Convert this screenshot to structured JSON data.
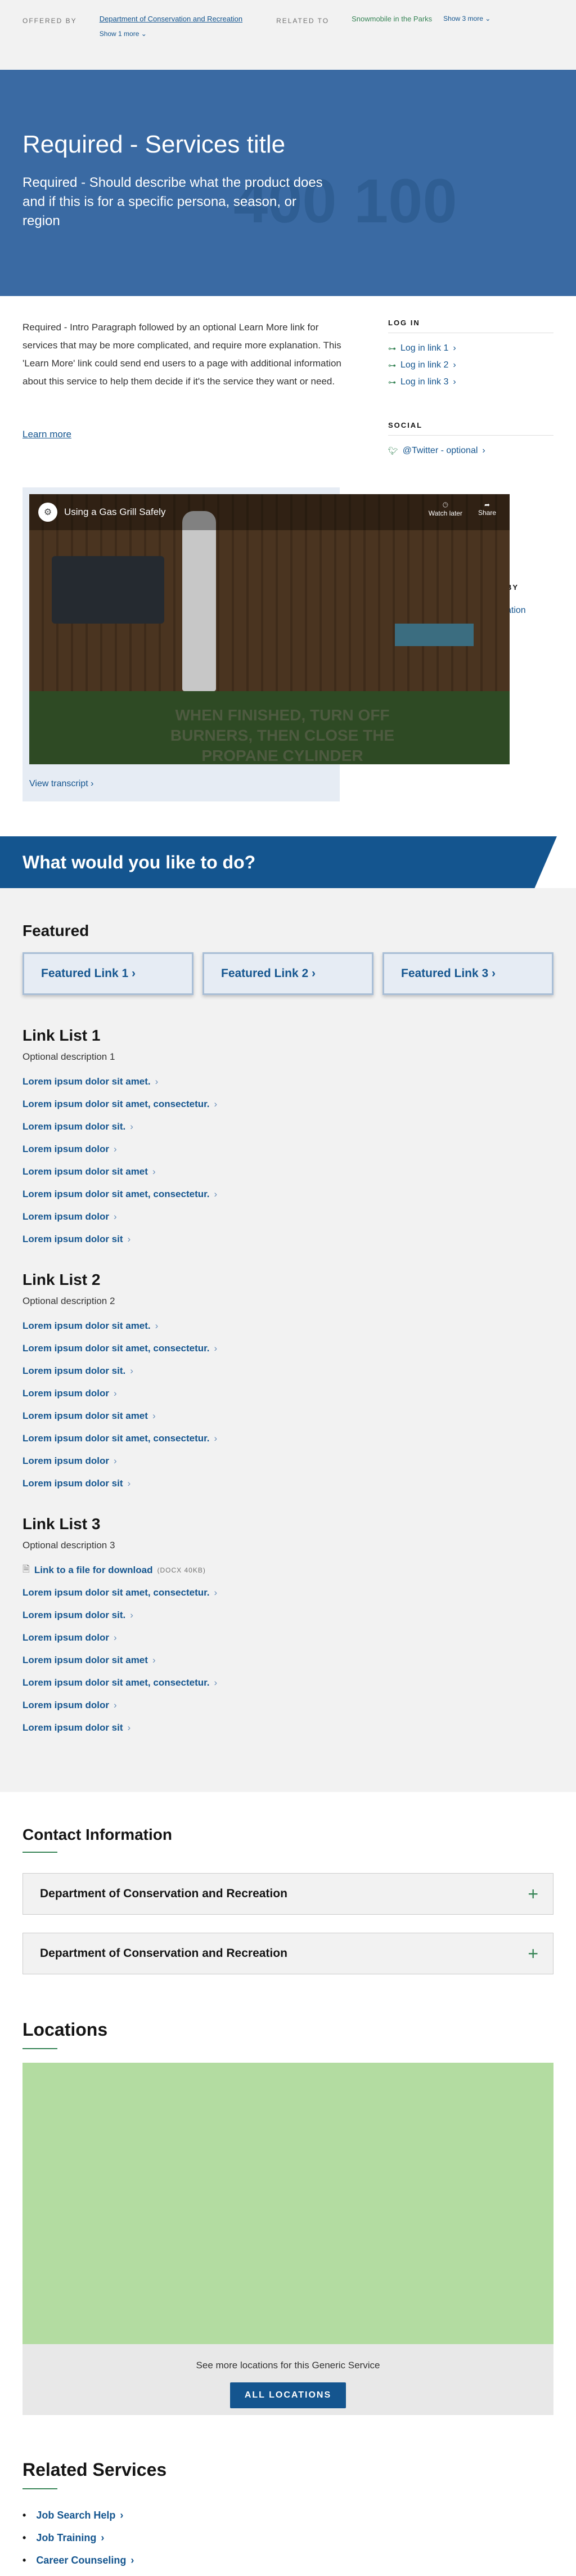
{
  "relationship": {
    "offered_by_label": "OFFERED BY",
    "offered_by_link": "Department of Conservation and Recreation",
    "offered_more": "Show 1 more",
    "related_label": "RELATED TO",
    "related_link": "Snowmobile in the Parks",
    "related_more": "Show 3 more"
  },
  "hero": {
    "title": "Required - Services title",
    "description": "Required - Should describe what the product does and if this is for a specific persona, season, or region",
    "watermark": "400 100"
  },
  "intro": {
    "text": "Required - Intro Paragraph followed by an optional Learn More link for services that may be more complicated, and require more explanation. This 'Learn More' link could send end users to a page with additional information about this service to help them decide if it's the service they want or need.",
    "learn_more": "Learn more"
  },
  "sidebar": {
    "login_title": "LOG IN",
    "login_links": [
      "Log in link 1",
      "Log in link 2",
      "Log in link 3"
    ],
    "social_title": "SOCIAL",
    "social_links": [
      "@Twitter - optional"
    ],
    "by_title": "BY",
    "by_link": "ation"
  },
  "video": {
    "title": "Using a Gas Grill Safely",
    "watch_later": "Watch later",
    "share": "Share",
    "caption": "WHEN FINISHED, TURN OFF BURNERS, THEN CLOSE THE PROPANE CYLINDER",
    "transcript": "View transcript"
  },
  "tasks": {
    "heading": "What would you like to do?",
    "featured_title": "Featured",
    "featured_links": [
      "Featured Link 1",
      "Featured Link 2",
      "Featured Link 3"
    ]
  },
  "link_lists": [
    {
      "title": "Link List 1",
      "description": "Optional description 1",
      "items": [
        "Lorem ipsum dolor sit amet.",
        "Lorem ipsum dolor sit amet, consectetur.",
        "Lorem ipsum dolor sit.",
        "Lorem ipsum dolor",
        "Lorem ipsum dolor sit amet",
        "Lorem ipsum dolor sit amet, consectetur.",
        "Lorem ipsum dolor",
        "Lorem ipsum dolor sit"
      ]
    },
    {
      "title": "Link List 2",
      "description": "Optional description 2",
      "items": [
        "Lorem ipsum dolor sit amet.",
        "Lorem ipsum dolor sit amet, consectetur.",
        "Lorem ipsum dolor sit.",
        "Lorem ipsum dolor",
        "Lorem ipsum dolor sit amet",
        "Lorem ipsum dolor sit amet, consectetur.",
        "Lorem ipsum dolor",
        "Lorem ipsum dolor sit"
      ]
    },
    {
      "title": "Link List 3",
      "description": "Optional description 3",
      "file_link": "Link to a file for download",
      "file_meta": "(DOCX 40KB)",
      "items": [
        "Lorem ipsum dolor sit amet, consectetur.",
        "Lorem ipsum dolor sit.",
        "Lorem ipsum dolor",
        "Lorem ipsum dolor sit amet",
        "Lorem ipsum dolor sit amet, consectetur.",
        "Lorem ipsum dolor",
        "Lorem ipsum dolor sit"
      ]
    }
  ],
  "contact": {
    "heading": "Contact Information",
    "accordions": [
      "Department of Conservation and Recreation",
      "Department of Conservation and Recreation"
    ]
  },
  "locations": {
    "heading": "Locations",
    "more_text": "See more locations for this Generic Service",
    "button": "ALL LOCATIONS"
  },
  "related_services": {
    "heading": "Related Services",
    "items": [
      "Job Search Help",
      "Job Training",
      "Career Counseling"
    ]
  },
  "colors": {
    "primary": "#14558f",
    "hero": "#3a6aa3",
    "accent_green": "#388557",
    "map": "#b3dca1"
  }
}
